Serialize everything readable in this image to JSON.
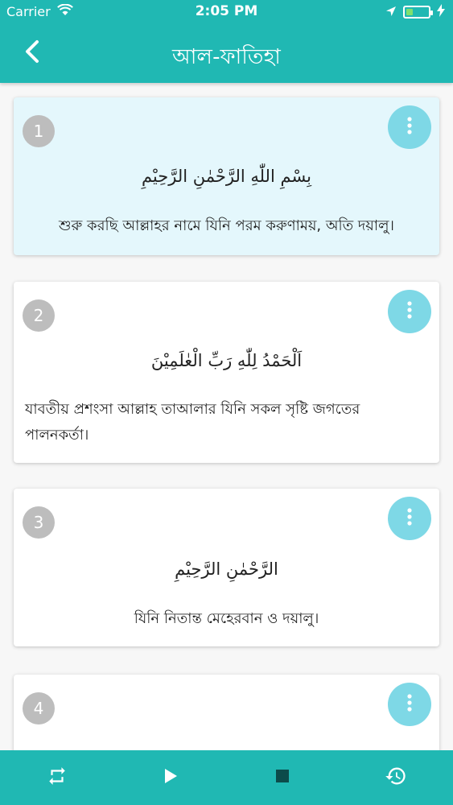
{
  "status_bar": {
    "carrier": "Carrier",
    "time": "2:05 PM",
    "battery_level": 0.3
  },
  "header": {
    "title": "আল-ফাতিহা"
  },
  "verses": [
    {
      "number": "1",
      "arabic": "بِسْمِ اللّٰهِ الرَّحْمٰنِ الرَّحِيْمِ",
      "translation": "শুরু করছি আল্লাহর নামে যিনি পরম করুণাময়, অতি দয়ালু।"
    },
    {
      "number": "2",
      "arabic": "اَلْحَمْدُ لِلّٰهِ رَبِّ الْعٰلَمِيْنَ",
      "translation": "যাবতীয় প্রশংসা আল্লাহ তাআলার যিনি সকল সৃষ্টি জগতের পালনকর্তা।"
    },
    {
      "number": "3",
      "arabic": "الرَّحْمٰنِ الرَّحِيْمِ",
      "translation": "যিনি নিতান্ত মেহেরবান ও দয়ালু।"
    },
    {
      "number": "4",
      "arabic": "",
      "translation": ""
    }
  ],
  "colors": {
    "primary": "#20b8b3",
    "highlight": "#e4f7fc",
    "badge": "#bdbdbd",
    "more_button": "#7ed8e6"
  },
  "icons": {
    "back": "chevron-left-icon",
    "more": "more-vert-icon",
    "repeat": "repeat-icon",
    "play": "play-icon",
    "stop": "stop-icon",
    "history": "history-icon"
  }
}
